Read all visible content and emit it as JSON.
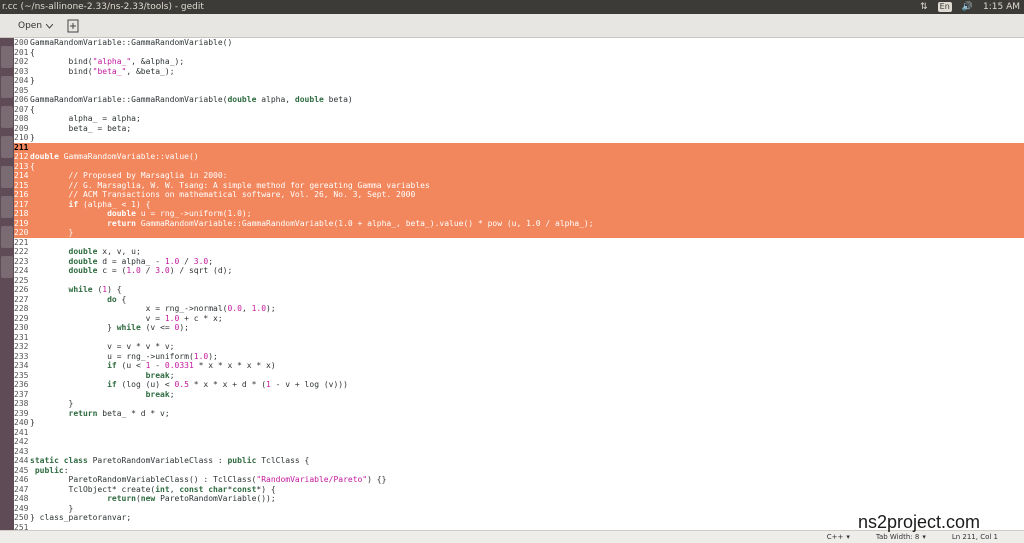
{
  "window": {
    "title": "r.cc (~/ns-allinone-2.33/ns-2.33/tools) - gedit",
    "lang_indicator": "En",
    "time": "1:15 AM"
  },
  "header": {
    "open_label": "Open",
    "open_icon": "chevron-down-icon",
    "new_icon": "new-document-icon"
  },
  "editor": {
    "lines": [
      {
        "n": "200",
        "html": "GammaRandomVariable::GammaRandomVariable()"
      },
      {
        "n": "201",
        "html": "{"
      },
      {
        "n": "202",
        "html": "        bind(<span class=\"str\">\"alpha_\"</span>, &amp;alpha_);"
      },
      {
        "n": "203",
        "html": "        bind(<span class=\"str\">\"beta_\"</span>, &amp;beta_);"
      },
      {
        "n": "204",
        "html": "}"
      },
      {
        "n": "205",
        "html": ""
      },
      {
        "n": "206",
        "html": "GammaRandomVariable::GammaRandomVariable(<span class=\"kw\">double</span> alpha, <span class=\"kw\">double</span> beta)"
      },
      {
        "n": "207",
        "html": "{"
      },
      {
        "n": "208",
        "html": "        alpha_ = alpha;"
      },
      {
        "n": "209",
        "html": "        beta_ = beta;"
      },
      {
        "n": "210",
        "html": "}"
      },
      {
        "n": "211",
        "html": "",
        "sel": true,
        "cur": true
      },
      {
        "n": "212",
        "html": "<span class=\"kw\">double</span> GammaRandomVariable::value()",
        "sel": true
      },
      {
        "n": "213",
        "html": "{",
        "sel": true
      },
      {
        "n": "214",
        "html": "        <span class=\"cm\">// Proposed by Marsaglia in 2000:</span>",
        "sel": true
      },
      {
        "n": "215",
        "html": "        <span class=\"cm\">// G. Marsaglia, W. W. Tsang: A simple method for gereating Gamma variables</span>",
        "sel": true
      },
      {
        "n": "216",
        "html": "        <span class=\"cm\">// ACM Transactions on mathematical software, Vol. 26, No. 3, Sept. 2000</span>",
        "sel": true
      },
      {
        "n": "217",
        "html": "        <span class=\"kw\">if</span> (alpha_ &lt; 1) {",
        "sel": true
      },
      {
        "n": "218",
        "html": "                <span class=\"kw\">double</span> u = rng_-&gt;uniform(1.0);",
        "sel": true
      },
      {
        "n": "219",
        "html": "                <span class=\"kw\">return</span> GammaRandomVariable::GammaRandomVariable(1.0 + alpha_, beta_).value() * pow (u, 1.0 / alpha_);",
        "sel": true
      },
      {
        "n": "220",
        "html": "        }",
        "sel": true
      },
      {
        "n": "221",
        "html": ""
      },
      {
        "n": "222",
        "html": "        <span class=\"kw\">double</span> x, v, u;"
      },
      {
        "n": "223",
        "html": "        <span class=\"kw\">double</span> d = alpha_ - <span class=\"num\">1.0</span> / <span class=\"num\">3.0</span>;"
      },
      {
        "n": "224",
        "html": "        <span class=\"kw\">double</span> c = (<span class=\"num\">1.0</span> / <span class=\"num\">3.0</span>) / sqrt (d);"
      },
      {
        "n": "225",
        "html": ""
      },
      {
        "n": "226",
        "html": "        <span class=\"kw\">while</span> (<span class=\"num\">1</span>) {"
      },
      {
        "n": "227",
        "html": "                <span class=\"kw\">do</span> {"
      },
      {
        "n": "228",
        "html": "                        x = rng_-&gt;normal(<span class=\"num\">0.0</span>, <span class=\"num\">1.0</span>);"
      },
      {
        "n": "229",
        "html": "                        v = <span class=\"num\">1.0</span> + c * x;"
      },
      {
        "n": "230",
        "html": "                } <span class=\"kw\">while</span> (v &lt;= <span class=\"num\">0</span>);"
      },
      {
        "n": "231",
        "html": ""
      },
      {
        "n": "232",
        "html": "                v = v * v * v;"
      },
      {
        "n": "233",
        "html": "                u = rng_-&gt;uniform(<span class=\"num\">1.0</span>);"
      },
      {
        "n": "234",
        "html": "                <span class=\"kw\">if</span> (u &lt; <span class=\"num\">1</span> - <span class=\"num\">0.0331</span> * x * x * x * x)"
      },
      {
        "n": "235",
        "html": "                        <span class=\"kw\">break</span>;"
      },
      {
        "n": "236",
        "html": "                <span class=\"kw\">if</span> (log (u) &lt; <span class=\"num\">0.5</span> * x * x + d * (<span class=\"num\">1</span> - v + log (v)))"
      },
      {
        "n": "237",
        "html": "                        <span class=\"kw\">break</span>;"
      },
      {
        "n": "238",
        "html": "        }"
      },
      {
        "n": "239",
        "html": "        <span class=\"kw\">return</span> beta_ * d * v;"
      },
      {
        "n": "240",
        "html": "}"
      },
      {
        "n": "241",
        "html": ""
      },
      {
        "n": "242",
        "html": ""
      },
      {
        "n": "243",
        "html": ""
      },
      {
        "n": "244",
        "html": "<span class=\"kw\">static class</span> ParetoRandomVariableClass : <span class=\"kw\">public</span> TclClass {"
      },
      {
        "n": "245",
        "html": " <span class=\"kw\">public</span>:"
      },
      {
        "n": "246",
        "html": "        ParetoRandomVariableClass() : TclClass(<span class=\"str\">\"RandomVariable/Pareto\"</span>) {}"
      },
      {
        "n": "247",
        "html": "        TclObject* create(<span class=\"kw\">int</span>, <span class=\"kw\">const char</span>*<span class=\"kw\">const</span>*) {"
      },
      {
        "n": "248",
        "html": "                <span class=\"kw\">return</span>(<span class=\"kw\">new</span> ParetoRandomVariable());"
      },
      {
        "n": "249",
        "html": "        }"
      },
      {
        "n": "250",
        "html": "} class_paretoranvar;"
      },
      {
        "n": "251",
        "html": ""
      }
    ]
  },
  "statusbar": {
    "language": "C++",
    "tab_width": "Tab Width: 8",
    "position": "Ln 211, Col 1"
  },
  "watermark": "ns2project.com"
}
